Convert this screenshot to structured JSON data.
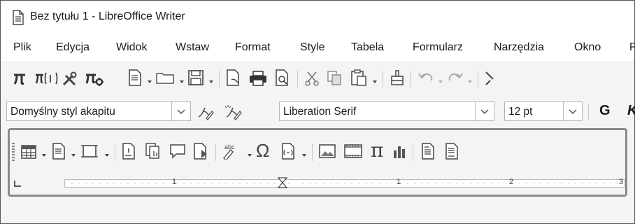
{
  "window": {
    "title": "Bez tytułu 1 - LibreOffice Writer"
  },
  "menubar": {
    "items": [
      {
        "label": "Plik"
      },
      {
        "label": "Edycja"
      },
      {
        "label": "Widok"
      },
      {
        "label": "Wstaw"
      },
      {
        "label": "Format"
      },
      {
        "label": "Style"
      },
      {
        "label": "Tabela"
      },
      {
        "label": "Formularz"
      },
      {
        "label": "Narzędzia"
      },
      {
        "label": "Okno"
      },
      {
        "label": "P"
      }
    ]
  },
  "standard_toolbar": {
    "icons": [
      "pi-icon",
      "formula-field-icon",
      "tools-icon",
      "math-formula-icon",
      "new-document-icon",
      "open-folder-icon",
      "save-icon",
      "export-pdf-icon",
      "print-icon",
      "print-preview-icon",
      "cut-icon",
      "copy-icon",
      "paste-icon",
      "clone-formatting-icon",
      "undo-icon",
      "redo-icon"
    ]
  },
  "formatting_toolbar": {
    "paragraph_style": "Domyślny styl akapitu",
    "font_name": "Liberation Serif",
    "font_size": "12 pt",
    "bold_label": "G",
    "italic_label": "K"
  },
  "insert_toolbar": {
    "icons": [
      "table-icon",
      "page-break-icon",
      "frame-icon",
      "footnote-icon",
      "cross-reference-icon",
      "comment-icon",
      "track-changes-icon",
      "spelling-icon",
      "special-character-icon",
      "field-icon",
      "image-icon",
      "media-icon",
      "formula-icon",
      "chart-icon",
      "header-icon",
      "footer-icon"
    ],
    "special_character_glyph": "Ω",
    "formula_glyph": "π",
    "spelling_glyph": "abc"
  },
  "ruler": {
    "labels": [
      "1",
      "1",
      "2",
      "3"
    ]
  },
  "colors": {
    "background": "#f4f4f4",
    "highlight_border": "#8a8a8a",
    "icon": "#4a4a4a"
  }
}
